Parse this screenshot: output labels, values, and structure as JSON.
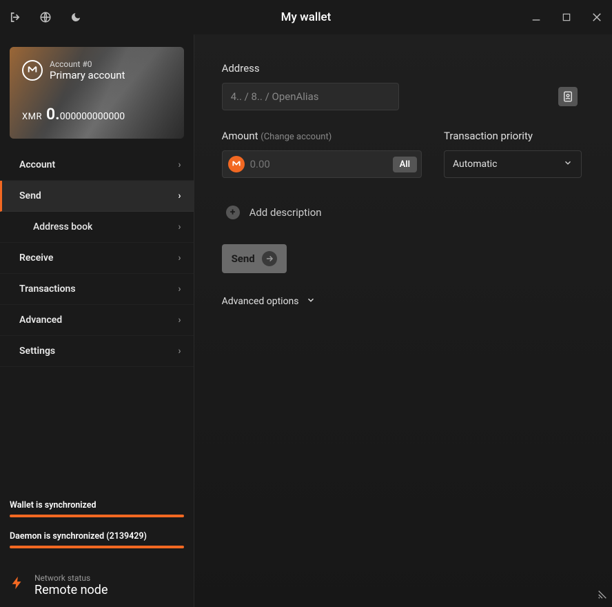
{
  "titlebar": {
    "title": "My wallet"
  },
  "account": {
    "sub": "Account #0",
    "name": "Primary account",
    "currency": "XMR",
    "balance_int": "0.",
    "balance_dec": "000000000000"
  },
  "nav": {
    "account": "Account",
    "send": "Send",
    "address_book": "Address book",
    "receive": "Receive",
    "transactions": "Transactions",
    "advanced": "Advanced",
    "settings": "Settings"
  },
  "status": {
    "wallet": "Wallet is synchronized",
    "daemon": "Daemon is synchronized (2139429)",
    "net_sub": "Network status",
    "net_main": "Remote node"
  },
  "form": {
    "address_label": "Address",
    "address_placeholder": "4.. / 8.. / OpenAlias",
    "amount_label": "Amount",
    "amount_hint": "(Change account)",
    "amount_placeholder": "0.00",
    "all_btn": "All",
    "priority_label": "Transaction priority",
    "priority_value": "Automatic",
    "add_description": "Add description",
    "send_btn": "Send",
    "advanced_options": "Advanced options"
  }
}
